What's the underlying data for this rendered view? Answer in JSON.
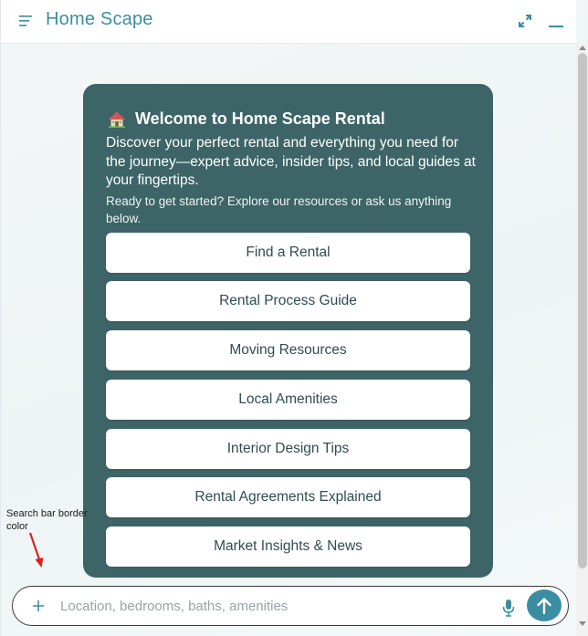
{
  "header": {
    "title": "Home Scape",
    "menu_icon": "menu-icon",
    "expand_icon": "expand-icon",
    "minimize_icon": "minimize-icon"
  },
  "welcome": {
    "icon": "house-icon",
    "title": "Welcome to Home Scape Rental",
    "description": "Discover your perfect rental and everything you need for the journey—expert advice, insider tips, and local guides at your fingertips.",
    "prompt": "Ready to get started? Explore our resources or ask us anything below.",
    "buttons": [
      {
        "label": "Find a Rental"
      },
      {
        "label": "Rental Process Guide"
      },
      {
        "label": "Moving Resources"
      },
      {
        "label": "Local Amenities"
      },
      {
        "label": "Interior Design Tips"
      },
      {
        "label": "Rental Agreements Explained"
      },
      {
        "label": "Market Insights & News"
      }
    ]
  },
  "annotation": {
    "text": "Search bar border color"
  },
  "search": {
    "placeholder": "Location, bedrooms, baths, amenities",
    "value": "",
    "plus_icon": "plus-icon",
    "mic_icon": "mic-icon",
    "send_icon": "arrow-up-icon"
  },
  "colors": {
    "accent": "#3b8ea1",
    "card_bg": "#3d6467",
    "search_border": "#3a3a3a",
    "annotation_arrow": "#e0201b"
  }
}
